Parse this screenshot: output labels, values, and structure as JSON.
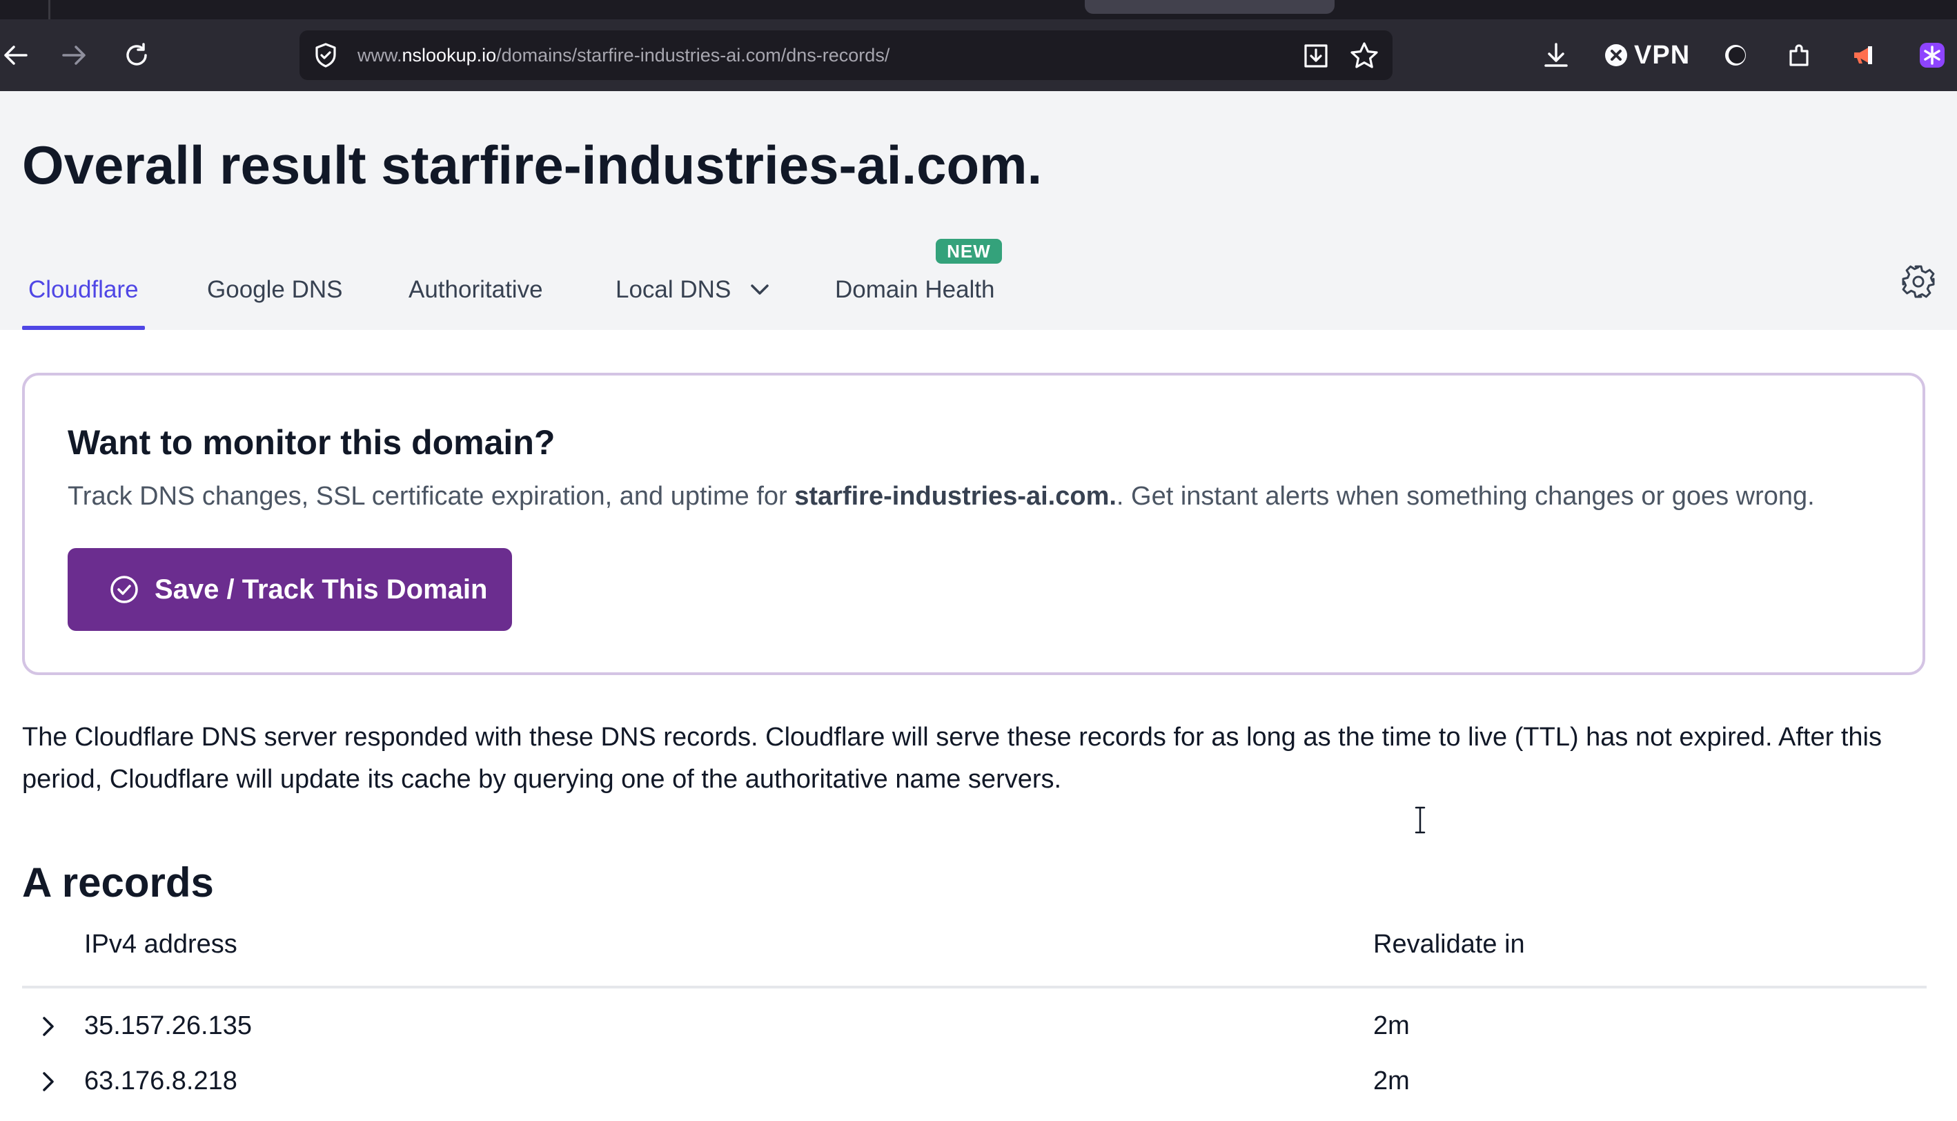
{
  "browser": {
    "url_prefix": "www.",
    "url_host": "nslookup.io",
    "url_path": "/domains/starfire-industries-ai.com/dns-records/",
    "vpn_label": "VPN",
    "icons": [
      "back-arrow-icon",
      "forward-arrow-icon",
      "reload-icon",
      "shield-icon",
      "page-save-icon",
      "star-icon",
      "download-icon",
      "vpn-icon",
      "dark-mode-icon",
      "extensions-icon",
      "megaphone-icon",
      "extension-purple-icon"
    ]
  },
  "page": {
    "title_prefix": "Overall result",
    "title_domain": "starfire-industries-ai.com."
  },
  "tabs": [
    {
      "label": "Cloudflare",
      "active": true
    },
    {
      "label": "Google DNS",
      "active": false
    },
    {
      "label": "Authoritative",
      "active": false
    },
    {
      "label": "Local DNS",
      "active": false
    },
    {
      "label": "Domain Health",
      "active": false
    }
  ],
  "new_badge": "NEW",
  "monitor_card": {
    "title": "Want to monitor this domain?",
    "desc_before": "Track DNS changes, SSL certificate expiration, and uptime for ",
    "desc_domain": "starfire-industries-ai.com.",
    "desc_after": ". Get instant alerts when something changes or goes wrong.",
    "button_label": "Save / Track This Domain"
  },
  "intro_text": "The Cloudflare DNS server responded with these DNS records. Cloudflare will serve these records for as long as the time to live (TTL) has not expired. After this period, Cloudflare will update its cache by querying one of the authoritative name servers.",
  "a_records": {
    "title": "A records",
    "columns": [
      "IPv4 address",
      "Revalidate in"
    ],
    "rows": [
      {
        "ip": "35.157.26.135",
        "revalidate": "2m"
      },
      {
        "ip": "63.176.8.218",
        "revalidate": "2m"
      }
    ]
  },
  "colors": {
    "accent": "#4f46e5",
    "button": "#6b2d8f",
    "badge": "#34a27b",
    "card_border": "#d4c4e4"
  }
}
